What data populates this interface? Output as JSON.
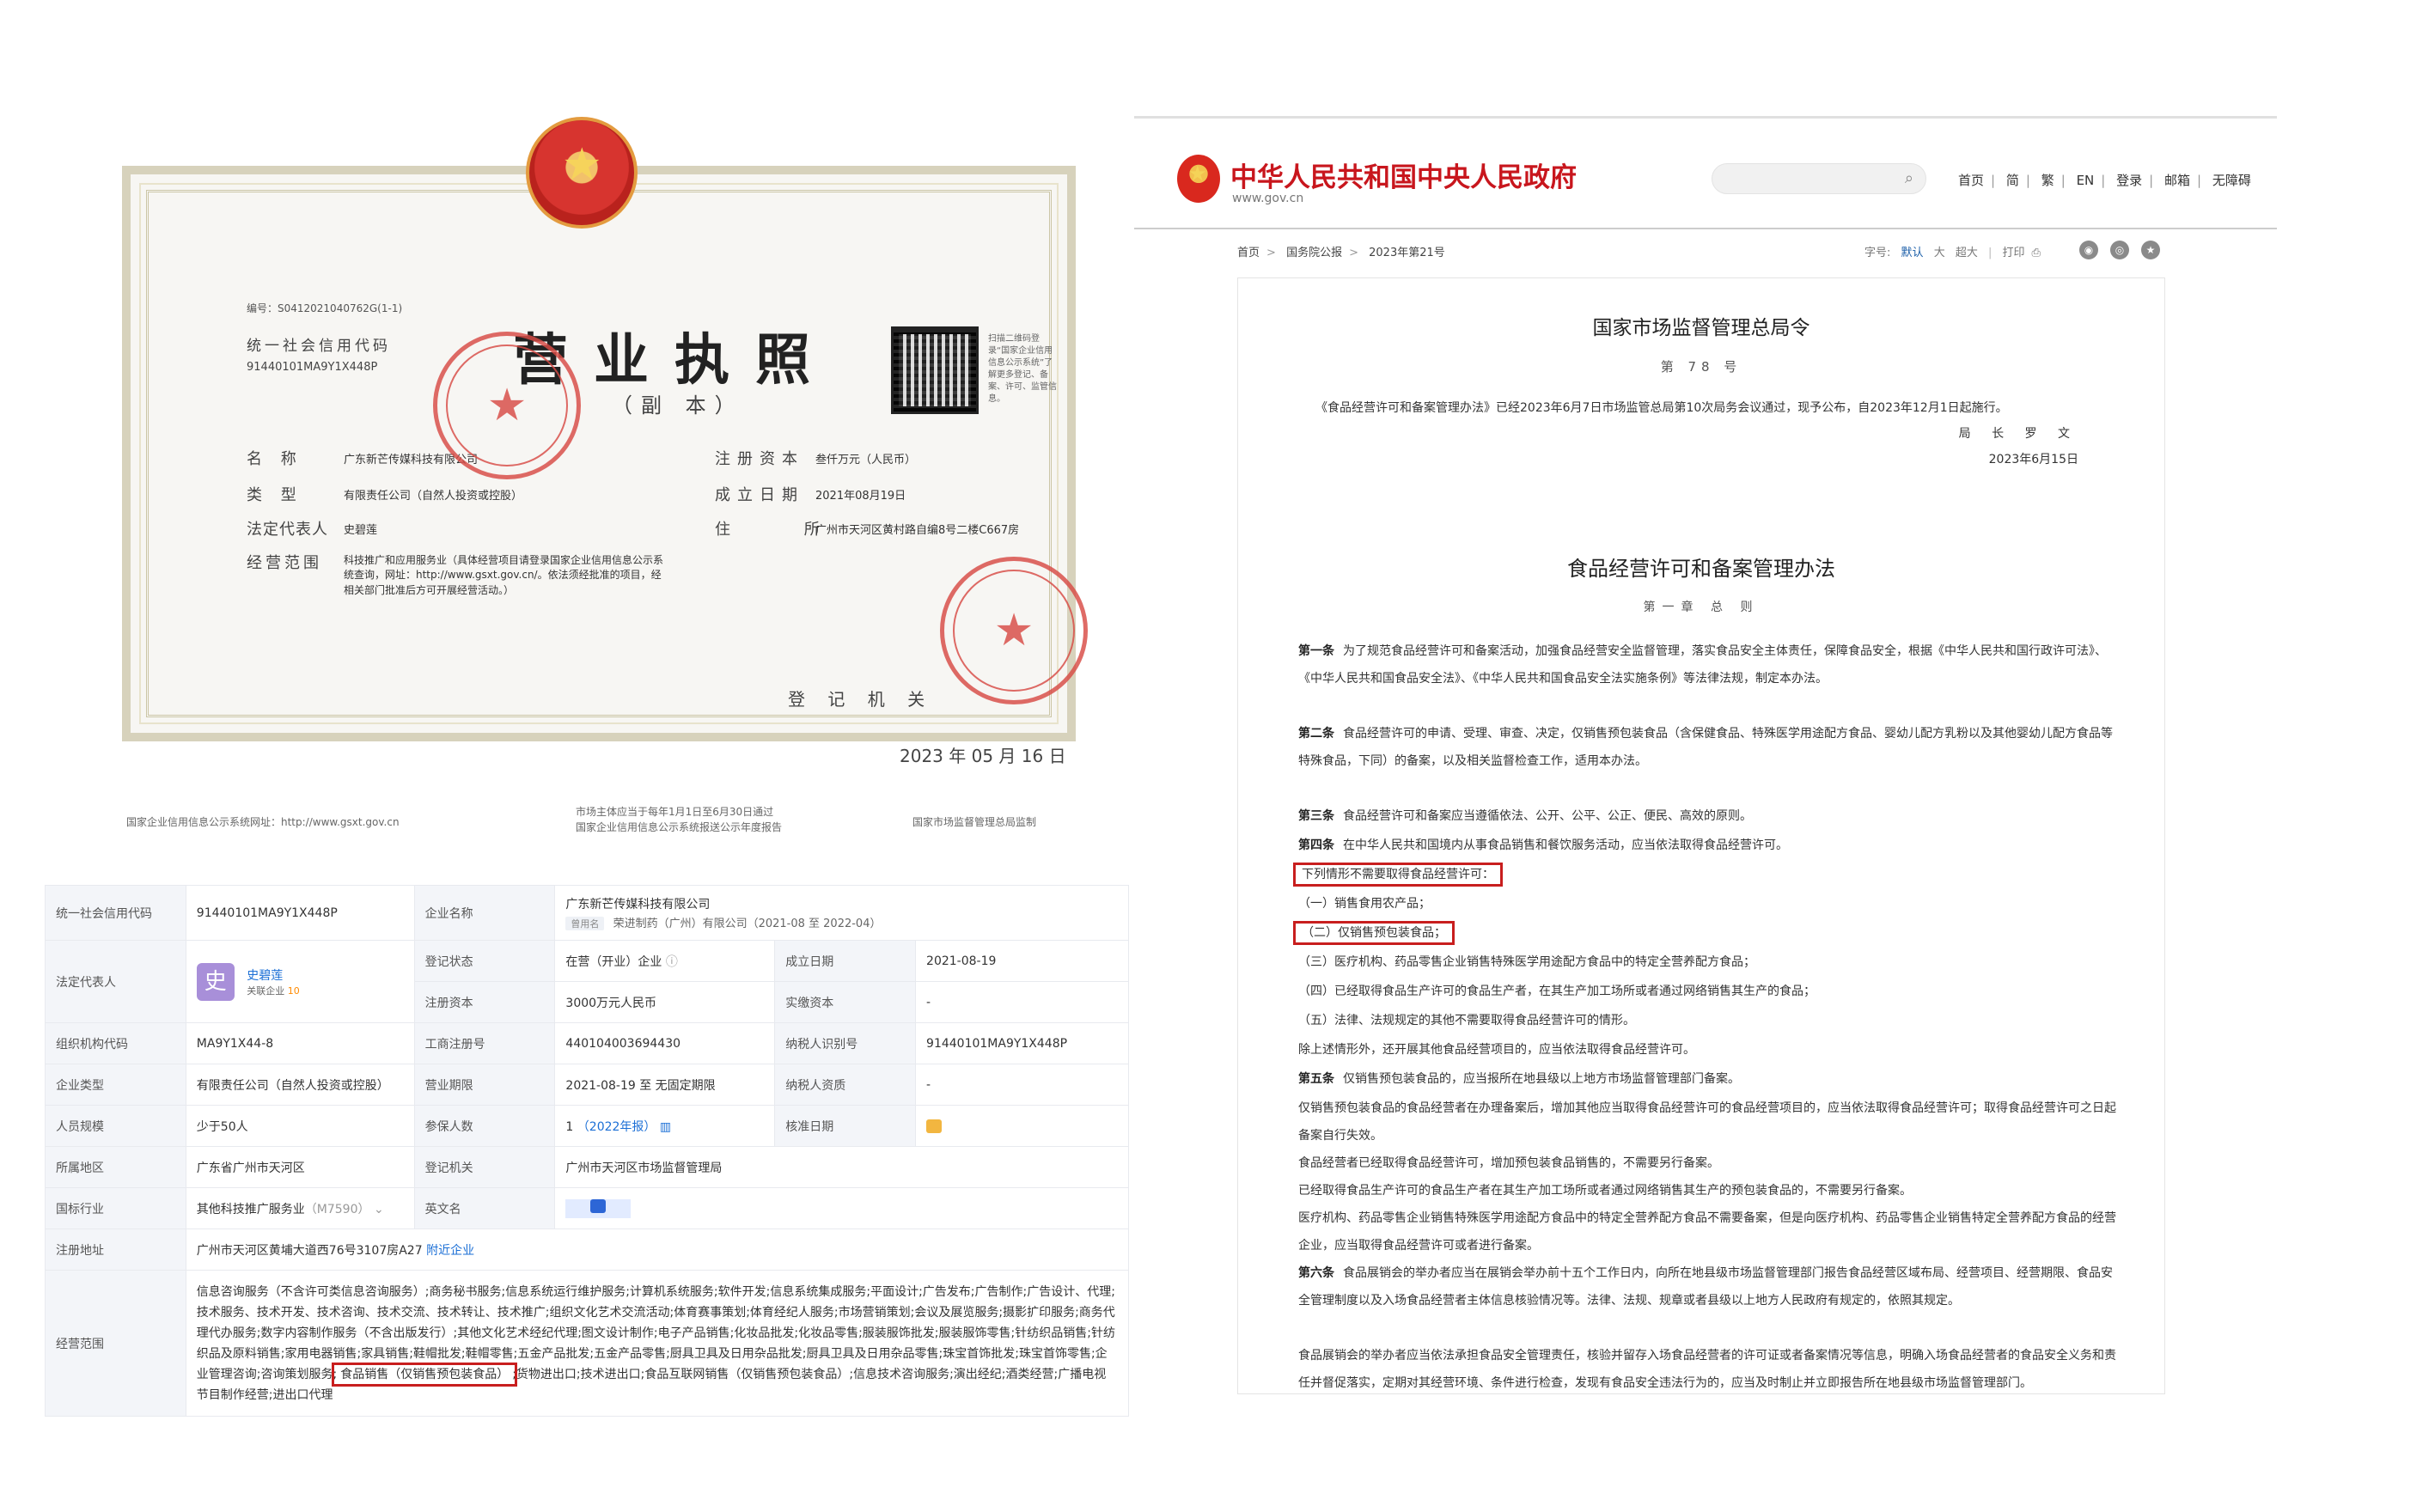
{
  "license": {
    "serial": "编号：S0412021040762G(1-1)",
    "credit_code_label": "统一社会信用代码",
    "credit_code": "91440101MA9Y1X448P",
    "title": "营业执照",
    "subtitle": "（副 本）",
    "qr_note": "扫描二维码登录“国家企业信用信息公示系统”了解更多登记、备案、许可、监管信息。",
    "rows": {
      "name_label": "名 称",
      "name_value": "广东新芒传媒科技有限公司",
      "type_label": "类 型",
      "type_value": "有限责任公司（自然人投资或控股）",
      "rep_label": "法定代表人",
      "rep_value": "史碧莲",
      "scope_label": "经营范围",
      "scope_value": "科技推广和应用服务业（具体经营项目请登录国家企业信用信息公示系统查询，网址：http://www.gsxt.gov.cn/。依法须经批准的项目，经相关部门批准后方可开展经营活动。）",
      "capital_label": "注册资本",
      "capital_value": "叁仟万元（人民币）",
      "date_label": "成立日期",
      "date_value": "2021年08月19日",
      "address_label": "住 所",
      "address_value": "广州市天河区黄村路自编8号二楼C667房"
    },
    "reg_authority": "登 记 机 关",
    "reg_date": "2023 年 05 月 16 日",
    "footer_left": "国家企业信用信息公示系统网址：http://www.gsxt.gov.cn",
    "footer_mid1": "市场主体应当于每年1月1日至6月30日通过",
    "footer_mid2": "国家企业信用信息公示系统报送公示年度报告",
    "footer_right": "国家市场监督管理总局监制"
  },
  "gov": {
    "site_name": "中华人民共和国中央人民政府",
    "site_url": "www.gov.cn",
    "nav": [
      "首页",
      "简",
      "繁",
      "EN",
      "登录",
      "邮箱",
      "无障碍"
    ],
    "breadcrumb": [
      "首页",
      "国务院公报",
      "2023年第21号"
    ],
    "font_label": "字号:",
    "font_default": "默认",
    "font_large": "大",
    "font_xlarge": "超大",
    "print_label": "打印",
    "order_title": "国家市场监督管理总局令",
    "order_no": "第 78 号",
    "preamble": "《食品经营许可和备案管理办法》已经2023年6月7日市场监管总局第10次局务会议通过，现予公布，自2023年12月1日起施行。",
    "signer": "局 长 罗 文",
    "sign_date": "2023年6月15日",
    "law_title": "食品经营许可和备案管理办法",
    "chapter": "第一章 总 则",
    "paragraphs": {
      "a1_head": "第一条",
      "a1": "为了规范食品经营许可和备案活动，加强食品经营安全监督管理，落实食品安全主体责任，保障食品安全，根据《中华人民共和国行政许可法》、《中华人民共和国食品安全法》、《中华人民共和国食品安全法实施条例》等法律法规，制定本办法。",
      "a2_head": "第二条",
      "a2": "食品经营许可的申请、受理、审查、决定，仅销售预包装食品（含保健食品、特殊医学用途配方食品、婴幼儿配方乳粉以及其他婴幼儿配方食品等特殊食品，下同）的备案，以及相关监督检查工作，适用本办法。",
      "a3_head": "第三条",
      "a3": "食品经营许可和备案应当遵循依法、公开、公平、公正、便民、高效的原则。",
      "a4_head": "第四条",
      "a4": "在中华人民共和国境内从事食品销售和餐饮服务活动，应当依法取得食品经营许可。",
      "a4_hl": "下列情形不需要取得食品经营许可：",
      "a4_i1": "（一）销售食用农产品；",
      "a4_i2": "（二）仅销售预包装食品；",
      "a4_i3": "（三）医疗机构、药品零售企业销售特殊医学用途配方食品中的特定全营养配方食品；",
      "a4_i4": "（四）已经取得食品生产许可的食品生产者，在其生产加工场所或者通过网络销售其生产的食品；",
      "a4_i5": "（五）法律、法规规定的其他不需要取得食品经营许可的情形。",
      "a4_end": "除上述情形外，还开展其他食品经营项目的，应当依法取得食品经营许可。",
      "a5_head": "第五条",
      "a5": "仅销售预包装食品的，应当报所在地县级以上地方市场监督管理部门备案。",
      "a5_2": "仅销售预包装食品的食品经营者在办理备案后，增加其他应当取得食品经营许可的食品经营项目的，应当依法取得食品经营许可；取得食品经营许可之日起备案自行失效。",
      "a5_3": "食品经营者已经取得食品经营许可，增加预包装食品销售的，不需要另行备案。",
      "a5_4": "已经取得食品生产许可的食品生产者在其生产加工场所或者通过网络销售其生产的预包装食品的，不需要另行备案。",
      "a5_5": "医疗机构、药品零售企业销售特殊医学用途配方食品中的特定全营养配方食品不需要备案，但是向医疗机构、药品零售企业销售特定全营养配方食品的经营企业，应当取得食品经营许可或者进行备案。",
      "a6_head": "第六条",
      "a6": "食品展销会的举办者应当在展销会举办前十五个工作日内，向所在地县级市场监督管理部门报告食品经营区域布局、经营项目、经营期限、食品安全管理制度以及入场食品经营者主体信息核验情况等。法律、法规、规章或者县级以上地方人民政府有规定的，依照其规定。",
      "a6_2": "食品展销会的举办者应当依法承担食品安全管理责任，核验并留存入场食品经营者的许可证或者备案情况等信息，明确入场食品经营者的食品安全义务和责任并督促落实，定期对其经营环境、条件进行检查，发现有食品安全违法行为的，应当及时制止并立即报告所在地县级市场监督管理部门。"
    }
  },
  "company": {
    "credit_code_label": "统一社会信用代码",
    "credit_code": "91440101MA9Y1X448P",
    "name_label": "企业名称",
    "name": "广东新芒传媒科技有限公司",
    "former_tag": "曾用名",
    "former_name": "荣进制药（广州）有限公司",
    "former_period": "（2021-08 至 2022-04）",
    "rep_label": "法定代表人",
    "rep_avatar": "史",
    "rep_name": "史碧莲",
    "rep_related": "关联企业",
    "rep_related_count": "10",
    "status_label": "登记状态",
    "status": "在营（开业）企业",
    "found_label": "成立日期",
    "found": "2021-08-19",
    "capital_label": "注册资本",
    "capital": "3000万元人民币",
    "paid_label": "实缴资本",
    "paid": "-",
    "org_label": "组织机构代码",
    "org": "MA9Y1X44-8",
    "reg_no_label": "工商注册号",
    "reg_no": "440104003694430",
    "taxid_label": "纳税人识别号",
    "taxid": "91440101MA9Y1X448P",
    "type_label": "企业类型",
    "type": "有限责任公司（自然人投资或控股）",
    "term_label": "营业期限",
    "term": "2021-08-19 至 无固定期限",
    "taxpayer_label": "纳税人资质",
    "taxpayer": "-",
    "size_label": "人员规模",
    "size": "少于50人",
    "insured_label": "参保人数",
    "insured": "1",
    "insured_year": "（2022年报）",
    "approve_label": "核准日期",
    "region_label": "所属地区",
    "region": "广东省广州市天河区",
    "authority_label": "登记机关",
    "authority": "广州市天河区市场监督管理局",
    "industry_label": "国标行业",
    "industry": "其他科技推广服务业",
    "industry_code": "（M7590）",
    "en_label": "英文名",
    "address_label": "注册地址",
    "address": "广州市天河区黄埔大道西76号3107房A27",
    "nearby": "附近企业",
    "scope_label": "经营范围",
    "scope_before": "信息咨询服务（不含许可类信息咨询服务）;商务秘书服务;信息系统运行维护服务;计算机系统服务;软件开发;信息系统集成服务;平面设计;广告发布;广告制作;广告设计、代理;技术服务、技术开发、技术咨询、技术交流、技术转让、技术推广;组织文化艺术交流活动;体育赛事策划;体育经纪人服务;市场营销策划;会议及展览服务;摄影扩印服务;商务代理代办服务;数字内容制作服务（不含出版发行）;其他文化艺术经纪代理;图文设计制作;电子产品销售;化妆品批发;化妆品零售;服装服饰批发;服装服饰零售;针纺织品销售;针纺织品及原料销售;家用电器销售;家具销售;鞋帽批发;鞋帽零售;五金产品批发;五金产品零售;厨具卫具及日用杂品批发;厨具卫具及日用杂品零售;珠宝首饰批发;珠宝首饰零售;企业管理咨询;咨询策划服务;",
    "scope_hl": "食品销售（仅销售预包装食品）",
    "scope_after": ";货物进出口;技术进出口;食品互联网销售（仅销售预包装食品）;信息技术咨询服务;演出经纪;酒类经营;广播电视节目制作经营;进出口代理"
  }
}
